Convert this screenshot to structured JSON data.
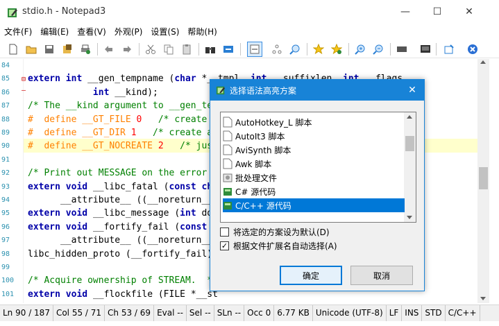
{
  "window": {
    "title": "stdio.h - Notepad3",
    "minimize_glyph": "—",
    "maximize_glyph": "☐",
    "close_glyph": "✕"
  },
  "menu": [
    "文件(F)",
    "编辑(E)",
    "查看(V)",
    "外观(P)",
    "设置(S)",
    "帮助(H)"
  ],
  "toolbar": {
    "icons": [
      "new-file-icon",
      "open-folder-icon",
      "save-icon",
      "save-as-icon",
      "print-icon",
      "undo-icon",
      "redo-icon",
      "cut-icon",
      "copy-icon",
      "paste-icon",
      "find-icon",
      "replace-icon",
      "word-wrap-icon",
      "goto-icon",
      "find-next-icon",
      "bookmark-icon",
      "bookmark-all-icon",
      "zoom-in-icon",
      "zoom-out-icon",
      "scheme-icon",
      "customize-icon",
      "settings-icon",
      "exit-icon"
    ]
  },
  "editor": {
    "line_numbers": [
      "84",
      "85",
      "86",
      "87",
      "88",
      "89",
      "90",
      "91",
      "92",
      "93",
      "94",
      "95",
      "96",
      "97",
      "98",
      "99",
      "100",
      "101"
    ],
    "highlight_color": "#ffffcc",
    "lines": [
      [],
      [
        {
          "t": "extern ",
          "c": "kw"
        },
        {
          "t": "int ",
          "c": "kw"
        },
        {
          "t": "__gen_tempname (",
          "c": ""
        },
        {
          "t": "char ",
          "c": "kw"
        },
        {
          "t": "*__tmpl, ",
          "c": ""
        },
        {
          "t": "int ",
          "c": "kw"
        },
        {
          "t": "__suffixlen, ",
          "c": ""
        },
        {
          "t": "int ",
          "c": "kw"
        },
        {
          "t": "__flags,",
          "c": ""
        }
      ],
      [
        {
          "t": "            ",
          "c": ""
        },
        {
          "t": "int ",
          "c": "kw"
        },
        {
          "t": "__kind);",
          "c": ""
        }
      ],
      [
        {
          "t": "/* The __kind argument to __gen_tem",
          "c": "cm"
        }
      ],
      [
        {
          "t": "#  define __GT_FILE ",
          "c": "pp"
        },
        {
          "t": "0",
          "c": "num"
        },
        {
          "t": "   /* create a",
          "c": "cm"
        }
      ],
      [
        {
          "t": "#  define __GT_DIR ",
          "c": "pp"
        },
        {
          "t": "1",
          "c": "num"
        },
        {
          "t": "   /* create a",
          "c": "cm"
        }
      ],
      [
        {
          "t": "#  define __GT_NOCREATE ",
          "c": "pp"
        },
        {
          "t": "2",
          "c": "num"
        },
        {
          "t": "   /* just",
          "c": "cm"
        }
      ],
      [],
      [
        {
          "t": "/* Print out MESSAGE on the error o",
          "c": "cm"
        }
      ],
      [
        {
          "t": "extern ",
          "c": "kw"
        },
        {
          "t": "void ",
          "c": "kw"
        },
        {
          "t": "__libc_fatal (",
          "c": ""
        },
        {
          "t": "const ",
          "c": "kw"
        },
        {
          "t": "cha",
          "c": "kw"
        }
      ],
      [
        {
          "t": "      __attribute__ ((__noreturn__))",
          "c": ""
        }
      ],
      [
        {
          "t": "extern ",
          "c": "kw"
        },
        {
          "t": "void ",
          "c": "kw"
        },
        {
          "t": "__libc_message (",
          "c": ""
        },
        {
          "t": "int ",
          "c": "kw"
        },
        {
          "t": "do",
          "c": ""
        }
      ],
      [
        {
          "t": "extern ",
          "c": "kw"
        },
        {
          "t": "void ",
          "c": "kw"
        },
        {
          "t": "__fortify_fail (",
          "c": ""
        },
        {
          "t": "const ",
          "c": "kw"
        },
        {
          "t": "c",
          "c": ""
        }
      ],
      [
        {
          "t": "      __attribute__ ((__noreturn__))",
          "c": ""
        }
      ],
      [
        {
          "t": "libc_hidden_proto (__fortify_fail)",
          "c": ""
        }
      ],
      [],
      [
        {
          "t": "/* Acquire ownership of STREAM.  */",
          "c": "cm"
        }
      ],
      [
        {
          "t": "extern ",
          "c": "kw"
        },
        {
          "t": "void ",
          "c": "kw"
        },
        {
          "t": "__flockfile (FILE *__st",
          "c": ""
        }
      ]
    ]
  },
  "status": [
    "Ln 90 / 187",
    "Col 55 / 71",
    "Ch 53 / 69",
    "Eval --",
    "Sel --",
    "SLn --",
    "Occ 0",
    "6.77 KB",
    "Unicode (UTF-8)",
    "LF",
    "INS",
    "STD",
    "C/C++"
  ],
  "dialog": {
    "title": "选择语法高亮方案",
    "close_glyph": "✕",
    "items": [
      {
        "label": "AutoHotkey_L 脚本",
        "icon": "document-icon",
        "selected": false
      },
      {
        "label": "AutoIt3 脚本",
        "icon": "document-icon",
        "selected": false
      },
      {
        "label": "AviSynth 脚本",
        "icon": "document-icon",
        "selected": false
      },
      {
        "label": "Awk 脚本",
        "icon": "document-icon",
        "selected": false
      },
      {
        "label": "批处理文件",
        "icon": "batch-file-icon",
        "selected": false
      },
      {
        "label": "C# 源代码",
        "icon": "csharp-file-icon",
        "selected": false
      },
      {
        "label": "C/C++ 源代码",
        "icon": "cpp-file-icon",
        "selected": true
      }
    ],
    "checkbox_default": {
      "label": "将选定的方案设为默认(D)",
      "checked": false
    },
    "checkbox_auto": {
      "label": "根据文件扩展名自动选择(A)",
      "checked": true
    },
    "check_mark": "✓",
    "ok_label": "确定",
    "cancel_label": "取消"
  }
}
